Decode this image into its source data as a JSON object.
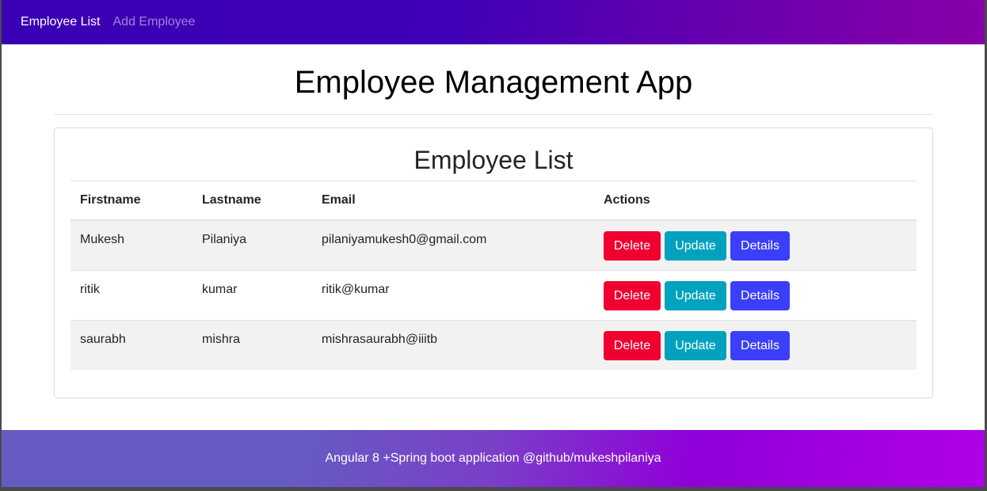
{
  "navbar": {
    "links": [
      {
        "label": "Employee List",
        "active": true
      },
      {
        "label": "Add Employee",
        "active": false
      }
    ]
  },
  "page": {
    "title": "Employee Management App"
  },
  "employee_list": {
    "title": "Employee List",
    "columns": [
      "Firstname",
      "Lastname",
      "Email",
      "Actions"
    ],
    "rows": [
      {
        "firstname": "Mukesh",
        "lastname": "Pilaniya",
        "email": "pilaniyamukesh0@gmail.com"
      },
      {
        "firstname": "ritik",
        "lastname": "kumar",
        "email": "ritik@kumar"
      },
      {
        "firstname": "saurabh",
        "lastname": "mishra",
        "email": "mishrasaurabh@iiitb"
      }
    ],
    "actions": {
      "delete_label": "Delete",
      "update_label": "Update",
      "details_label": "Details"
    }
  },
  "colors": {
    "delete": "#f0002f",
    "update": "#00a2bd",
    "details": "#3b3ff9",
    "navbar_start": "#3a00b4",
    "navbar_end": "#8800a8",
    "footer_start": "#665bc3",
    "footer_end": "#b000e8"
  },
  "footer": {
    "text": "Angular 8 +Spring boot application @github/mukeshpilaniya"
  }
}
